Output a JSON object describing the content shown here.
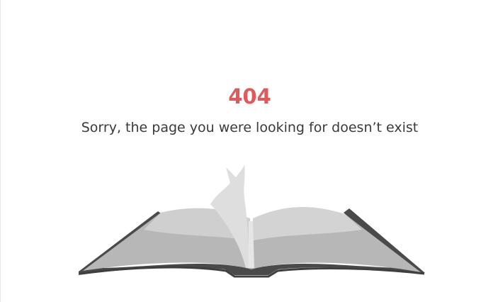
{
  "error": {
    "code": "404",
    "message": "Sorry, the page you were looking for doesn’t exist"
  },
  "illustration": {
    "icon": "open-book-icon"
  },
  "colors": {
    "accent": "#e05a5a",
    "text": "#3a3a3a",
    "background": "#ffffff"
  }
}
